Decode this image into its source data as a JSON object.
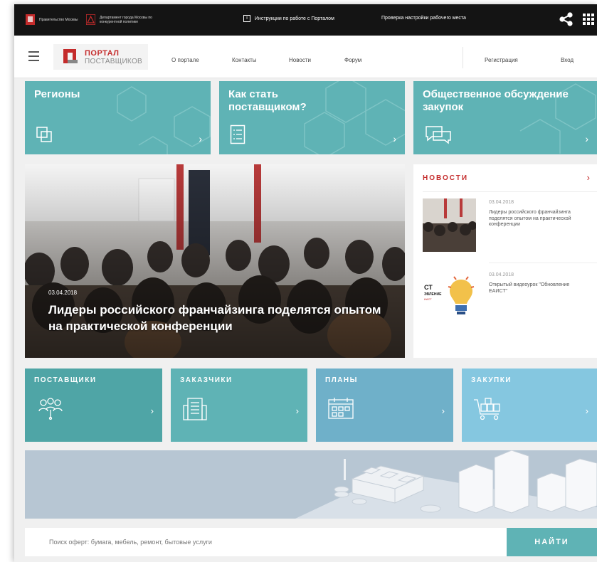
{
  "topbar": {
    "gov_moscow": "Правительство Москвы",
    "gov_dept": "Департамент города Москвы по конкурентной политике",
    "instructions": "Инструкции по работе с Порталом",
    "check_settings": "Проверка настройки рабочего места",
    "share_icon": "share-icon",
    "apps_icon": "grid-icon"
  },
  "nav": {
    "logo_line1": "ПОРТАЛ",
    "logo_line2": "ПОСТАВЩИКОВ",
    "links": [
      "О портале",
      "Контакты",
      "Новости",
      "Форум"
    ],
    "register": "Регистрация",
    "login": "Вход"
  },
  "tiles": [
    {
      "title": "Регионы",
      "icon": "layers-icon"
    },
    {
      "title": "Как стать поставщиком?",
      "icon": "document-list-icon"
    },
    {
      "title": "Общественное обсуждение закупок",
      "icon": "chat-icon"
    }
  ],
  "hero": {
    "date": "03.04.2018",
    "title": "Лидеры российского франчайзинга поделятся опытом на практической конференции"
  },
  "news": {
    "heading": "НОВОСТИ",
    "items": [
      {
        "date": "03.04.2018",
        "text": "Лидеры российского франчайзинга поделятся опытом на практической конференции"
      },
      {
        "date": "03.04.2018",
        "text": "Открытый видеоурок \"Обновление ЕАИСТ\""
      }
    ],
    "thumb2_lines": [
      "СТ",
      "ЭВЛЕНИЕ",
      "ИАСТ"
    ]
  },
  "categories": [
    {
      "label": "ПОСТАВЩИКИ",
      "color": "#4fa5a6"
    },
    {
      "label": "ЗАКАЗЧИКИ",
      "color": "#5fb3b5"
    },
    {
      "label": "ПЛАНЫ",
      "color": "#6fb0c9"
    },
    {
      "label": "ЗАКУПКИ",
      "color": "#85c7e0"
    }
  ],
  "search": {
    "placeholder": "Поиск оферт: бумага, мебель, ремонт, бытовые услуги",
    "button": "НАЙТИ"
  },
  "colors": {
    "accent_red": "#c42b2b",
    "teal": "#5fb3b5",
    "topbar": "#141414"
  }
}
